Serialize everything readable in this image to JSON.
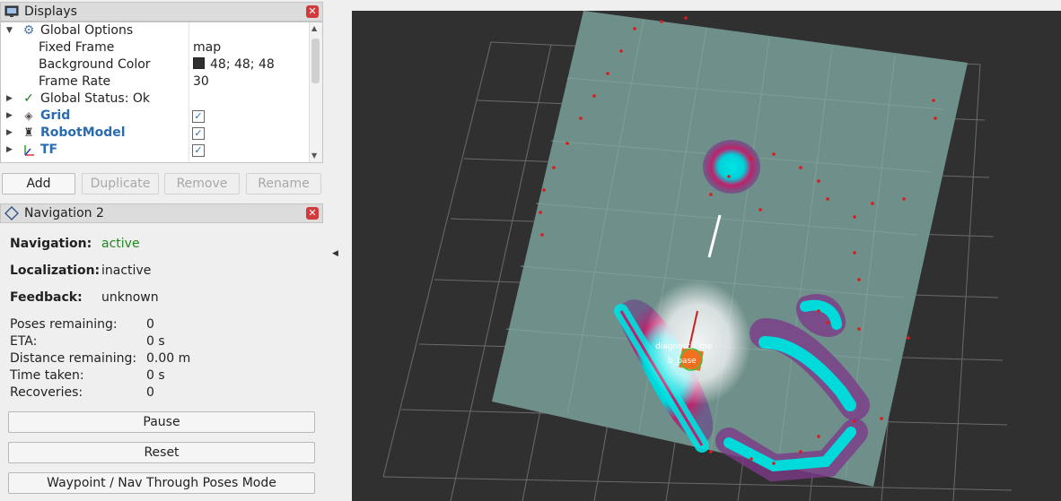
{
  "displays_panel": {
    "title": "Displays",
    "global_options": {
      "label": "Global Options"
    },
    "fixed_frame": {
      "label": "Fixed Frame",
      "value": "map"
    },
    "background_color": {
      "label": "Background Color",
      "value": "48; 48; 48",
      "color": "#303030"
    },
    "frame_rate": {
      "label": "Frame Rate",
      "value": "30"
    },
    "global_status": {
      "label": "Global Status: Ok"
    },
    "grid": {
      "label": "Grid",
      "checked": true
    },
    "robot_model": {
      "label": "RobotModel",
      "checked": true
    },
    "tf": {
      "label": "TF",
      "checked": true
    }
  },
  "display_buttons": {
    "add": "Add",
    "duplicate": "Duplicate",
    "remove": "Remove",
    "rename": "Rename"
  },
  "navigation_panel": {
    "title": "Navigation 2",
    "navigation": {
      "label": "Navigation:",
      "value": "active"
    },
    "localization": {
      "label": "Localization:",
      "value": "inactive"
    },
    "feedback": {
      "label": "Feedback:",
      "value": "unknown"
    },
    "poses_remaining": {
      "label": "Poses remaining:",
      "value": "0"
    },
    "eta": {
      "label": "ETA:",
      "value": "0 s"
    },
    "distance_remaining": {
      "label": "Distance remaining:",
      "value": "0.00 m"
    },
    "time_taken": {
      "label": "Time taken:",
      "value": "0 s"
    },
    "recoveries": {
      "label": "Recoveries:",
      "value": "0"
    },
    "pause_button": "Pause",
    "reset_button": "Reset",
    "mode_button": "Waypoint / Nav Through Poses Mode"
  },
  "viewport": {
    "background_color": "#303030",
    "map_color": "#6f8f8a",
    "frame_labels": {
      "laser": "diagnostic me",
      "base": "b_base"
    }
  },
  "colors": {
    "accent_blue": "#2b6cb0",
    "active_green": "#1e8a1e",
    "close_red": "#d23b3b"
  }
}
